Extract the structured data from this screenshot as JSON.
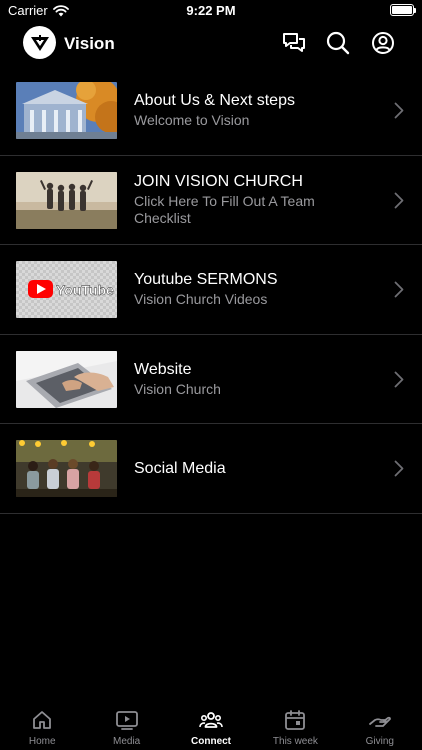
{
  "status_bar": {
    "carrier": "Carrier",
    "time": "9:22 PM",
    "battery_level": 1.0
  },
  "header": {
    "title": "Vision",
    "icons": [
      "chat-bubbles-icon",
      "search-icon",
      "profile-icon"
    ]
  },
  "items": [
    {
      "title": "About Us & Next steps",
      "subtitle": "Welcome to Vision",
      "thumb": "church-building"
    },
    {
      "title": "JOIN VISION CHURCH",
      "subtitle": "Click Here To Fill Out A Team Checklist",
      "thumb": "group-sunset"
    },
    {
      "title": "Youtube SERMONS",
      "subtitle": "Vision Church Videos",
      "thumb": "youtube-logo"
    },
    {
      "title": "Website",
      "subtitle": "Vision Church",
      "thumb": "laptop-typing"
    },
    {
      "title": "Social Media",
      "subtitle": "",
      "thumb": "friends-phones"
    }
  ],
  "tabs": [
    {
      "label": "Home",
      "icon": "home-icon",
      "active": false
    },
    {
      "label": "Media",
      "icon": "play-icon",
      "active": false
    },
    {
      "label": "Connect",
      "icon": "people-icon",
      "active": true
    },
    {
      "label": "This week",
      "icon": "calendar-icon",
      "active": false
    },
    {
      "label": "Giving",
      "icon": "giving-hand-icon",
      "active": false
    }
  ]
}
